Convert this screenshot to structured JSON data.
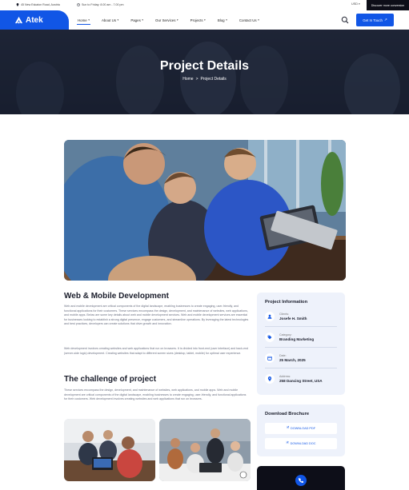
{
  "topbar": {
    "address": "45 New Eskaton Road, Austria",
    "hours": "Sun to Friday: 8.00 am - 7.00 pm",
    "currency": "USD",
    "dark_promo": "Discover more conversion"
  },
  "nav": {
    "logo": "Atek",
    "items": [
      {
        "label": "Home",
        "active": true
      },
      {
        "label": "About Us",
        "active": false
      },
      {
        "label": "Pages",
        "active": false
      },
      {
        "label": "Our Services",
        "active": false
      },
      {
        "label": "Projects",
        "active": false
      },
      {
        "label": "Blog",
        "active": false
      },
      {
        "label": "Contact Us",
        "active": false
      }
    ],
    "cta": "Get In Touch"
  },
  "hero": {
    "title": "Project Details",
    "crumb_home": "Home",
    "crumb_sep": ">",
    "crumb_current": "Project Details"
  },
  "main": {
    "heading1": "Web & Mobile Development",
    "para1": "Web and mobile development are critical components of the digital landscape, enabling businesses to create engaging, user-friendly, and functional applications for their customers. These services encompass the design, development, and maintenance of websites, web applications, and mobile apps. Below are some key details about web and mobile development services. Web and mobile development services are essential for businesses looking to establish a strong digital presence, engage customers, and streamline operations. By leveraging the latest technologies and best practices, developers can create solutions that drive growth and innovation.",
    "para2": "Web development involves creating websites and web applications that run on browsers. It is divided into front-end (user interface) and back-end (server-side logic) development. Creating websites that adapt to different screen sizes (desktop, tablet, mobile) for optimal user experience.",
    "heading2": "The challenge of project",
    "para3": "These services encompass the design, development, and maintenance of websites, web applications, and mobile apps. Web and mobile development are critical components of the digital landscape, enabling businesses to create engaging, user-friendly, and functional applications for their customers. Web development involves creating websites and web applications that run on browsers."
  },
  "info": {
    "title": "Project Information",
    "rows": [
      {
        "label": "Clients:",
        "value": "Josefe H. Smith",
        "icon": "user-icon"
      },
      {
        "label": "Category:",
        "value": "Branding Marketing",
        "icon": "tag-icon"
      },
      {
        "label": "Date:",
        "value": "25 March, 2025",
        "icon": "calendar-icon"
      },
      {
        "label": "Address:",
        "value": "258 Dancing Street, USA",
        "icon": "location-icon"
      }
    ]
  },
  "download": {
    "title": "Download Brochure",
    "pdf": "DOWNLOAD PDF",
    "doc": "DOWNLOAD DOC"
  },
  "colors": {
    "primary": "#1156e6",
    "dark": "#0d0e18",
    "panel": "#eef2fb"
  }
}
